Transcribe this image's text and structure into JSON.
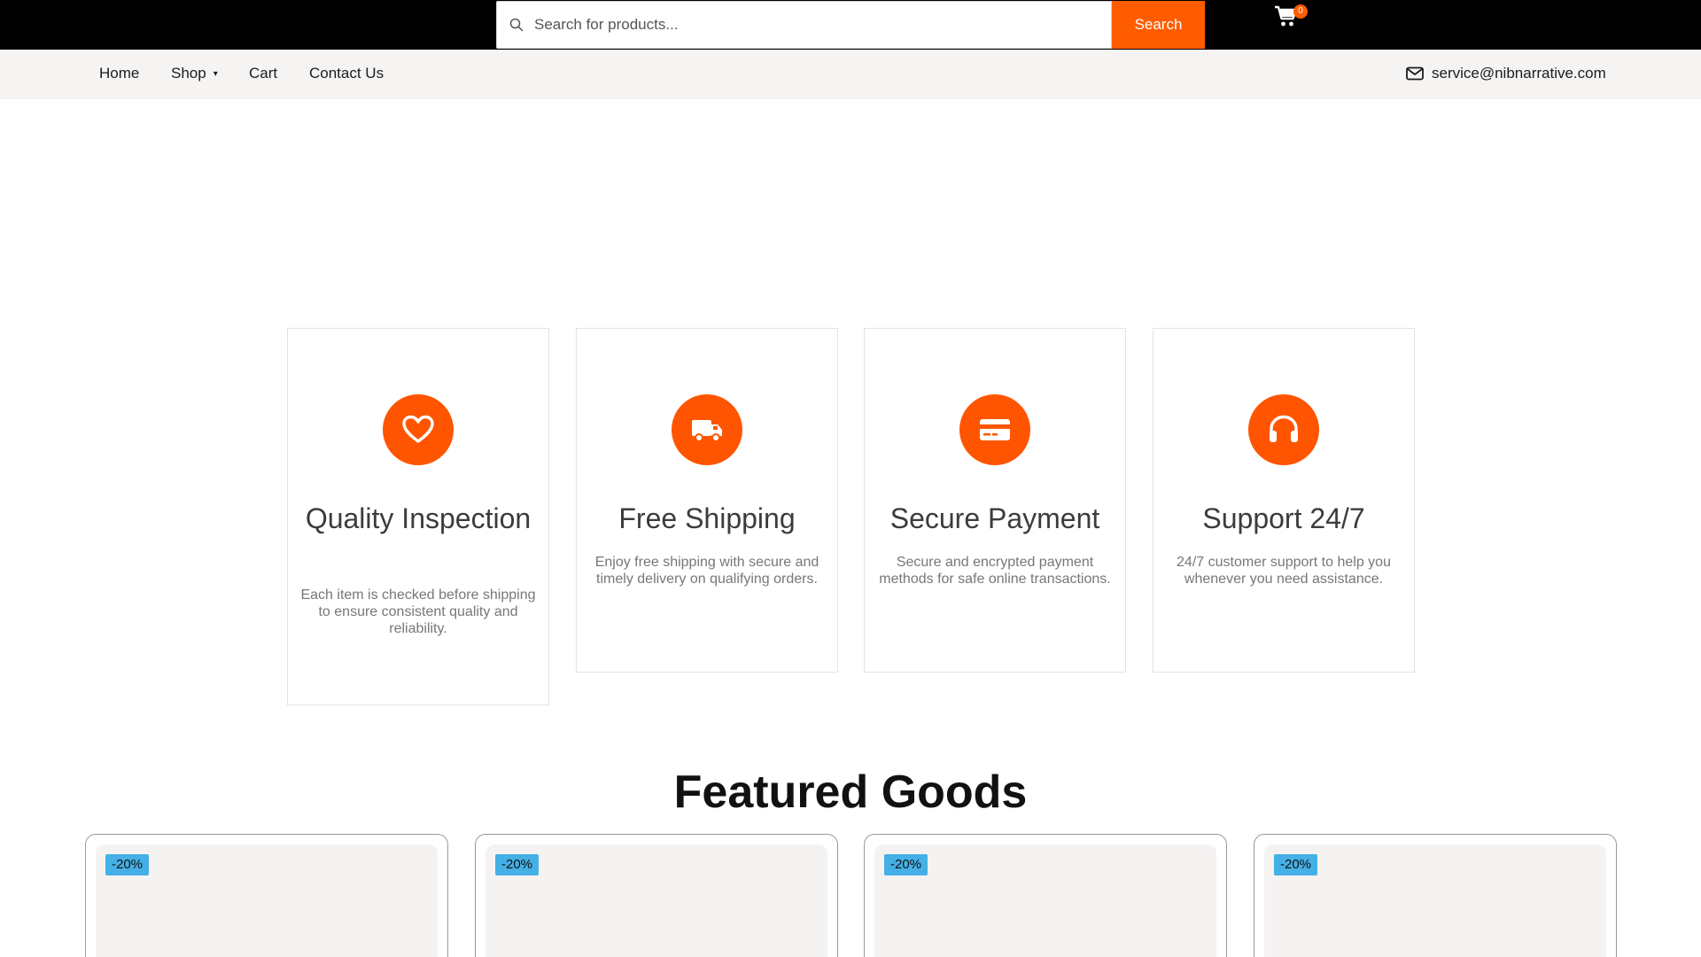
{
  "header": {
    "search_placeholder": "Search for products...",
    "search_button": "Search",
    "cart_count": "0"
  },
  "nav": {
    "items": [
      "Home",
      "Shop",
      "Cart",
      "Contact Us"
    ],
    "email": "service@nibnarrative.com"
  },
  "features": [
    {
      "icon": "heart-icon",
      "title": "Quality Inspection",
      "text": "Each item is checked before shipping to ensure consistent quality and reliability."
    },
    {
      "icon": "truck-icon",
      "title": "Free Shipping",
      "text": "Enjoy free shipping with secure and timely delivery on qualifying orders."
    },
    {
      "icon": "credit-card-icon",
      "title": "Secure Payment",
      "text": "Secure and encrypted payment methods for safe online transactions."
    },
    {
      "icon": "headphones-icon",
      "title": "Support 24/7",
      "text": "24/7 customer support to help you whenever you need assistance."
    }
  ],
  "featured": {
    "title": "Featured Goods",
    "products": [
      {
        "discount": "-20%"
      },
      {
        "discount": "-20%"
      },
      {
        "discount": "-20%"
      },
      {
        "discount": "-20%"
      }
    ]
  },
  "colors": {
    "accent": "#ff5500",
    "badge": "#45b0e6",
    "topbar": "#000000",
    "navbar": "#f6f4f3"
  }
}
